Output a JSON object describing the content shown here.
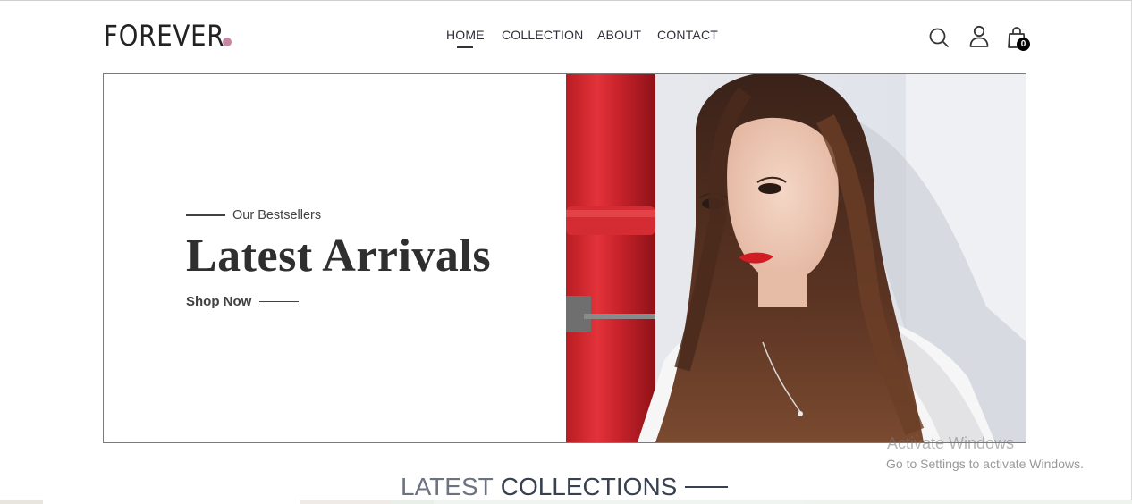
{
  "header": {
    "logo_text": "FOREVER",
    "logo_dot_color": "#c586a5",
    "nav": [
      {
        "label": "HOME",
        "active": true
      },
      {
        "label": "COLLECTION",
        "active": false
      },
      {
        "label": "ABOUT",
        "active": false
      },
      {
        "label": "CONTACT",
        "active": false
      }
    ],
    "icons": [
      "search-icon",
      "profile-icon",
      "cart-icon"
    ],
    "cart_count": "0"
  },
  "hero": {
    "eyebrow": "Our Bestsellers",
    "title": "Latest Arrivals",
    "cta": "Shop Now",
    "image": "woman-portrait-red-pipe"
  },
  "section": {
    "title_light": "LATEST",
    "title_bold": "COLLECTIONS"
  },
  "watermark": {
    "title": "Activate Windows",
    "subtitle": "Go to Settings to activate Windows."
  }
}
